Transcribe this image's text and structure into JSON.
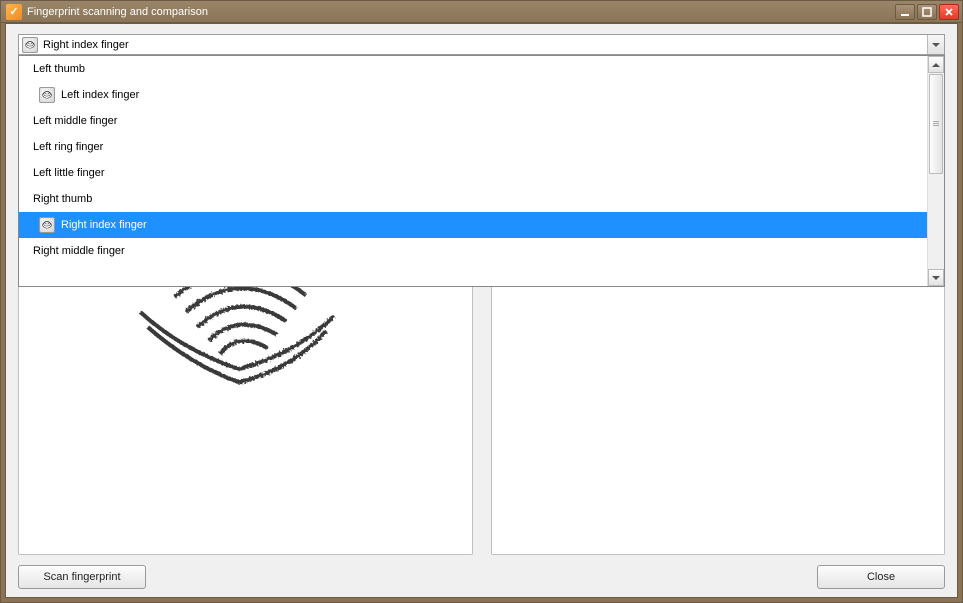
{
  "window": {
    "title": "Fingerprint scanning and comparison"
  },
  "combo": {
    "selected_label": "Right index finger",
    "items": [
      {
        "label": "Left thumb",
        "has_icon": false,
        "selected": false
      },
      {
        "label": "Left index finger",
        "has_icon": true,
        "selected": false
      },
      {
        "label": "Left middle finger",
        "has_icon": false,
        "selected": false
      },
      {
        "label": "Left ring finger",
        "has_icon": false,
        "selected": false
      },
      {
        "label": "Left little finger",
        "has_icon": false,
        "selected": false
      },
      {
        "label": "Right thumb",
        "has_icon": false,
        "selected": false
      },
      {
        "label": "Right index finger",
        "has_icon": true,
        "selected": true
      },
      {
        "label": "Right middle finger",
        "has_icon": false,
        "selected": false
      }
    ]
  },
  "buttons": {
    "scan": "Scan fingerprint",
    "close": "Close"
  }
}
